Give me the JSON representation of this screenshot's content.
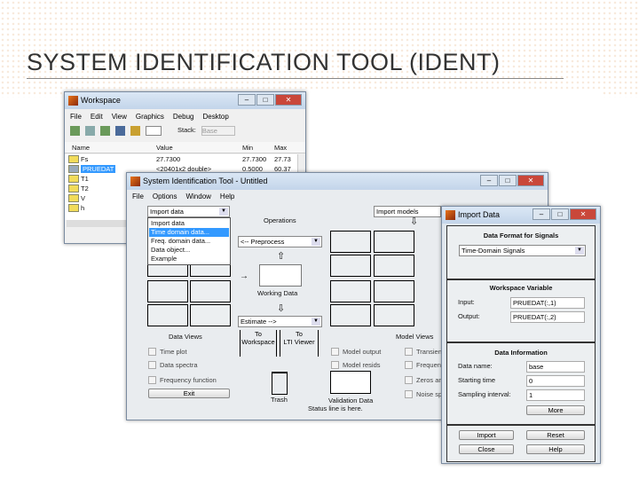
{
  "slide": {
    "title": "SYSTEM IDENTIFICATION TOOL (IDENT)"
  },
  "workspace": {
    "title": "Workspace",
    "menu": [
      "File",
      "Edit",
      "View",
      "Graphics",
      "Debug",
      "Desktop"
    ],
    "stack_label": "Stack:",
    "stack_value": "Base",
    "columns": [
      "Name",
      "Value",
      "Min",
      "Max"
    ],
    "rows": [
      {
        "name": "Fs",
        "value": "27.7300",
        "min": "27.7300",
        "max": "27.73"
      },
      {
        "name": "PRUEDAT",
        "value": "<20401x2 double>",
        "min": "0.5000",
        "max": "60.37"
      },
      {
        "name": "T1",
        "value": "",
        "min": "",
        "max": ""
      },
      {
        "name": "T2",
        "value": "",
        "min": "",
        "max": ""
      },
      {
        "name": "V",
        "value": "",
        "min": "",
        "max": ""
      },
      {
        "name": "h",
        "value": "",
        "min": "",
        "max": ""
      }
    ]
  },
  "ident": {
    "title": "System Identification Tool - Untitled",
    "menu": [
      "File",
      "Options",
      "Window",
      "Help"
    ],
    "import_data": "Import data",
    "import_options": [
      "Import data",
      "Time domain data...",
      "Freq. domain data...",
      "Data object...",
      "Example"
    ],
    "options_label": "Operations",
    "preprocess": "<-- Preprocess",
    "working_data": "Working Data",
    "estimate": "Estimate -->",
    "import_models": "Import models",
    "data_views": "Data Views",
    "model_views": "Model Views",
    "to_workspace": [
      "To",
      "Workspace"
    ],
    "to_lti": [
      "To",
      "LTI Viewer"
    ],
    "data_checks": [
      "Time plot",
      "Data spectra",
      "Frequency function"
    ],
    "model_checks": [
      "Model output",
      "Model resids"
    ],
    "model_checks2": [
      "Transient",
      "Frequency",
      "Zeros and",
      "Noise spectrum"
    ],
    "exit": "Exit",
    "trash": "Trash",
    "validation": "Validation Data",
    "status": "Status line is here."
  },
  "import_dialog": {
    "title": "Import Data",
    "format_heading": "Data Format for Signals",
    "format_value": "Time-Domain Signals",
    "ws_heading": "Workspace Variable",
    "input_label": "Input:",
    "input_value": "PRUEDAT(:,1)",
    "output_label": "Output:",
    "output_value": "PRUEDAT(:,2)",
    "info_heading": "Data Information",
    "name_label": "Data name:",
    "name_value": "base",
    "start_label": "Starting time",
    "start_value": "0",
    "interval_label": "Sampling interval:",
    "interval_value": "1",
    "more": "More",
    "import": "Import",
    "reset": "Reset",
    "close": "Close",
    "help": "Help"
  }
}
